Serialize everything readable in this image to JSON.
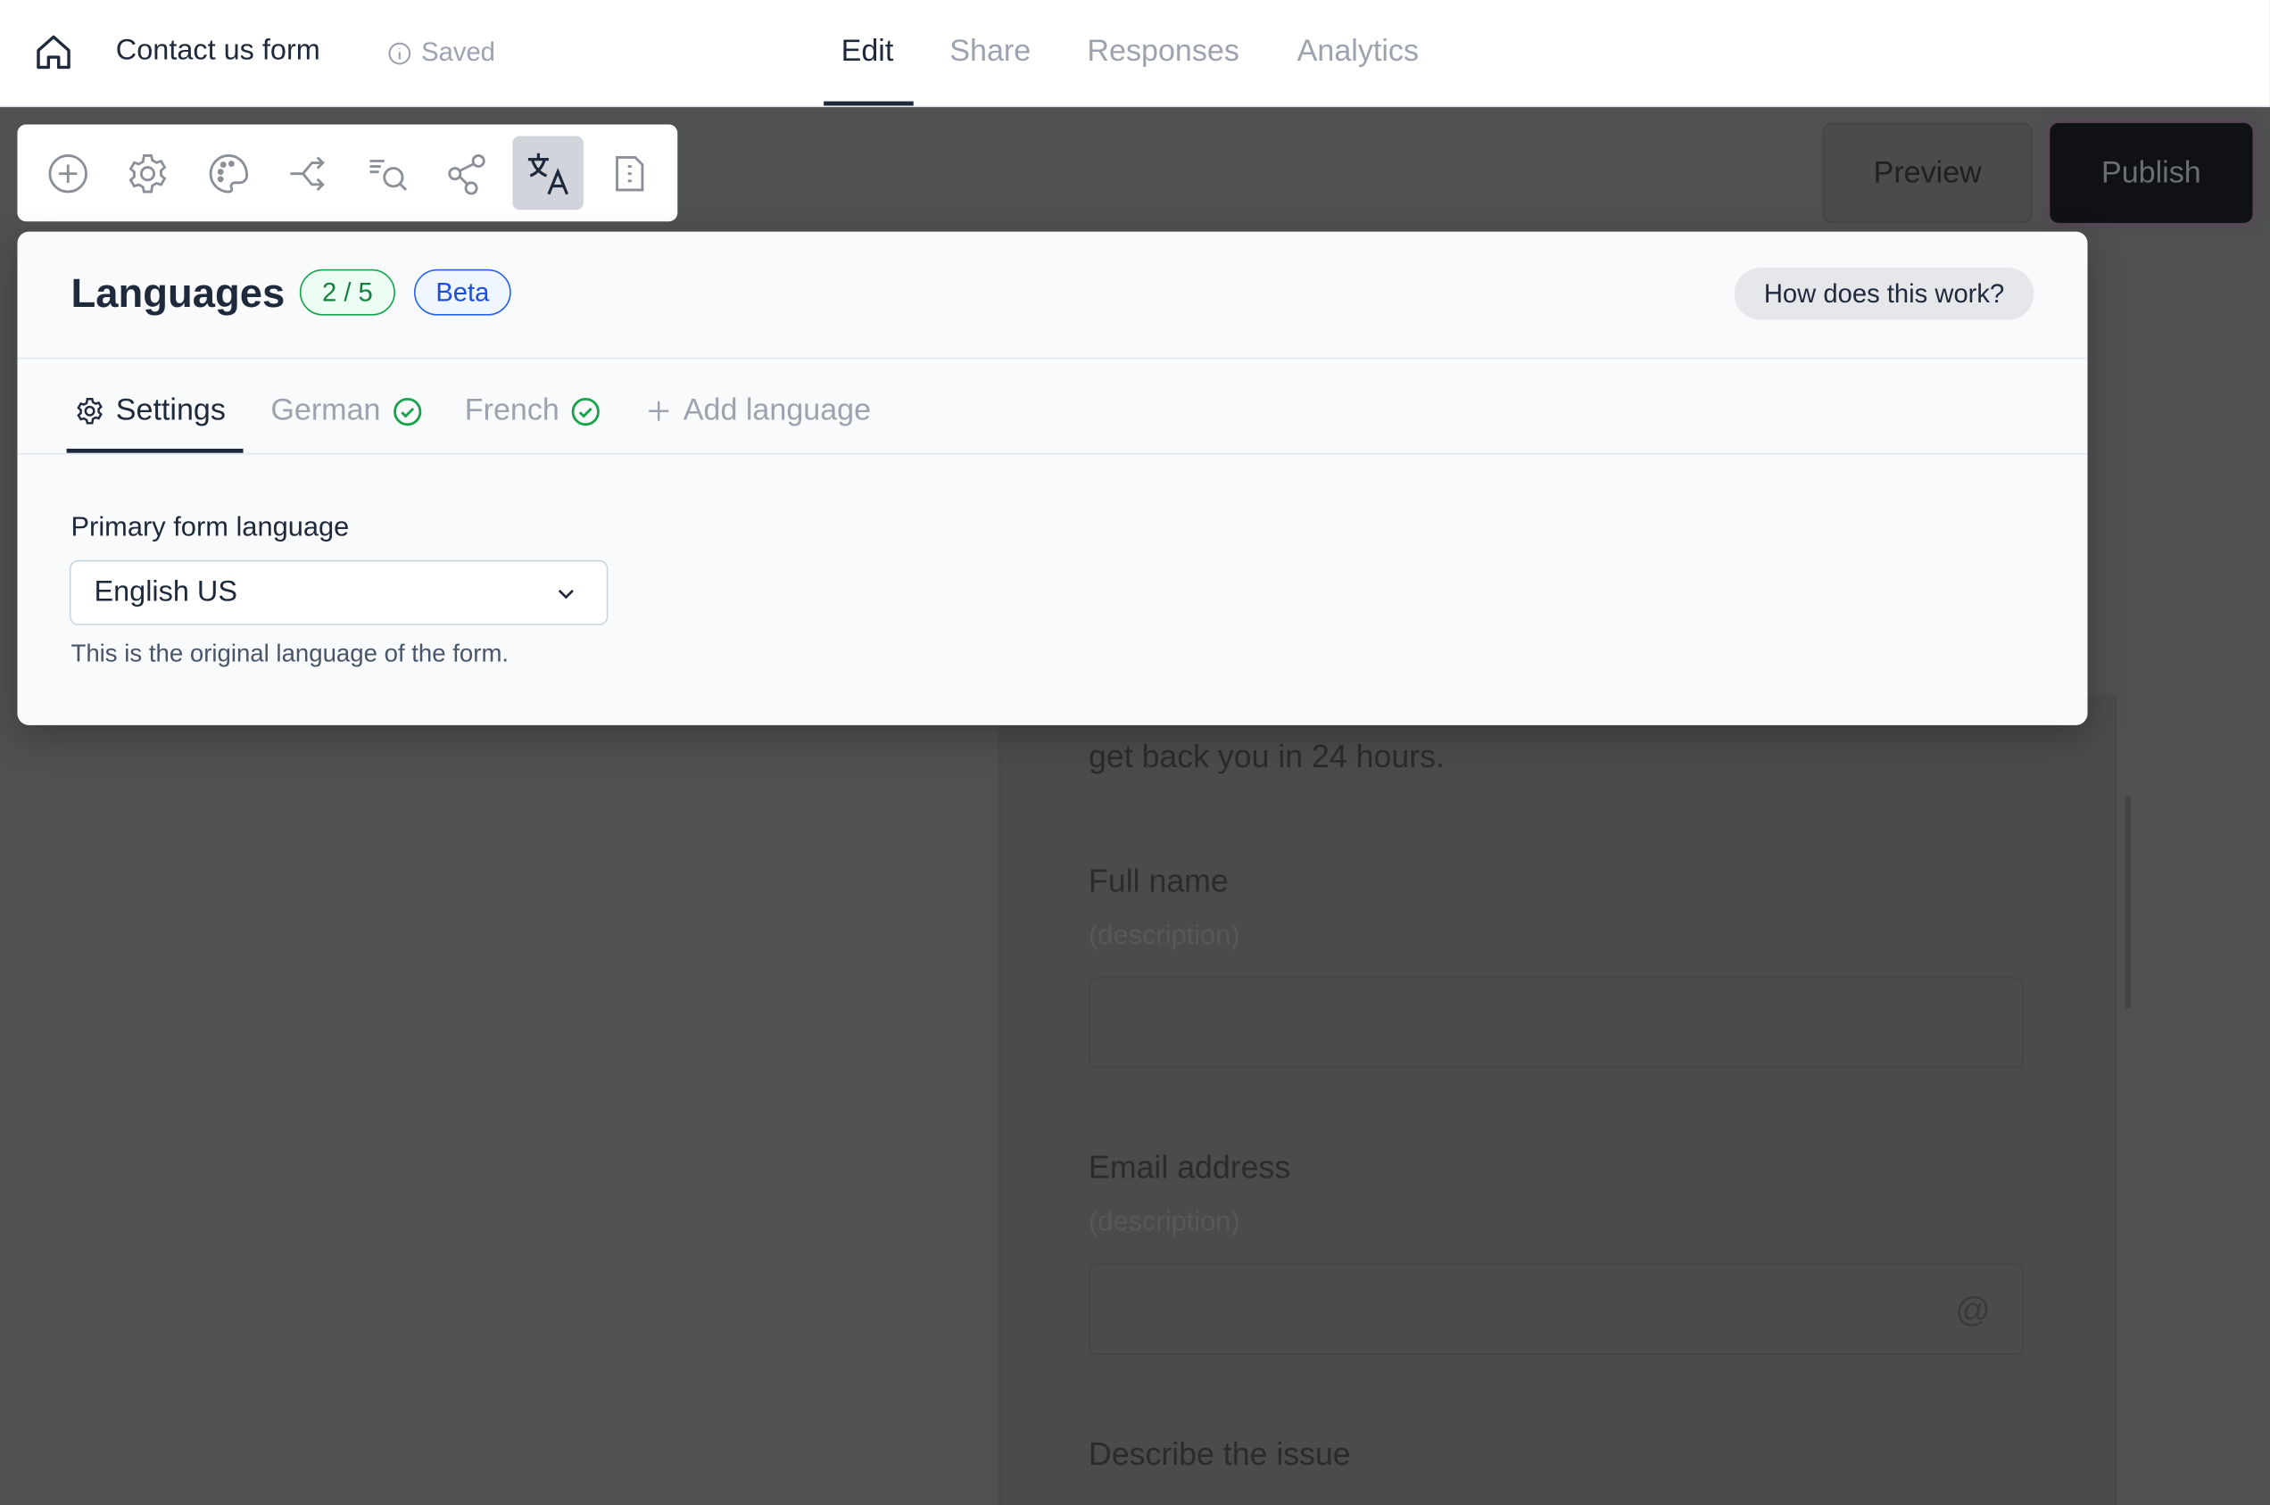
{
  "header": {
    "form_title": "Contact us form",
    "status": "Saved",
    "tabs": [
      {
        "label": "Edit",
        "active": true
      },
      {
        "label": "Share",
        "active": false
      },
      {
        "label": "Responses",
        "active": false
      },
      {
        "label": "Analytics",
        "active": false
      }
    ]
  },
  "toolbar": {
    "icons": [
      "plus-circle-icon",
      "gear-icon",
      "palette-icon",
      "branch-icon",
      "search-list-icon",
      "share-icon",
      "translate-icon",
      "document-icon"
    ],
    "active": "translate-icon"
  },
  "actions": {
    "preview": "Preview",
    "publish": "Publish"
  },
  "languages_panel": {
    "title": "Languages",
    "count_badge": "2 / 5",
    "beta_badge": "Beta",
    "help_button": "How does this work?",
    "tabs": [
      {
        "label": "Settings",
        "active": true
      },
      {
        "label": "German",
        "complete": true
      },
      {
        "label": "French",
        "complete": true
      },
      {
        "label": "Add language"
      }
    ],
    "primary_language_label": "Primary form language",
    "primary_language_value": "English US",
    "primary_language_help": "This is the original language of the form."
  },
  "form_preview": {
    "intro_tail": "get back you in 24 hours.",
    "fields": [
      {
        "label": "Full name",
        "description": "(description)"
      },
      {
        "label": "Email address",
        "description": "(description)"
      },
      {
        "label": "Describe the issue"
      }
    ]
  },
  "colors": {
    "accent_dark": "#1e293b",
    "success": "#16a34a",
    "beta": "#2563eb",
    "overlay": "#4f5050"
  }
}
